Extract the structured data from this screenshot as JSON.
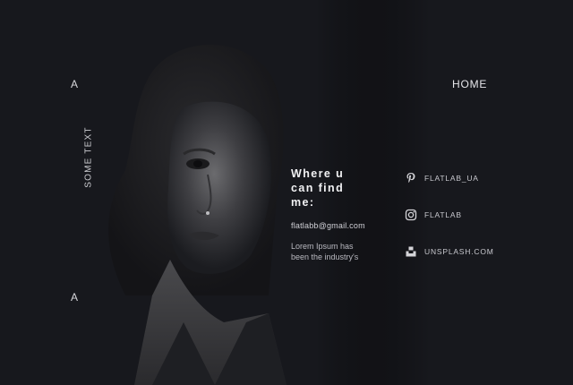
{
  "brand": {
    "logo_top": "A",
    "logo_bottom": "A",
    "vertical_text": "SOME TEXT"
  },
  "nav": {
    "home_label": "HOME"
  },
  "contact": {
    "heading_lines": [
      "Where u",
      "can find",
      "me:"
    ],
    "email": "flatlabb@gmail.com",
    "desc_lines": [
      "Lorem Ipsum has",
      "been the industry's"
    ]
  },
  "social": [
    {
      "icon": "pinterest-icon",
      "label": "FLATLAB_UA"
    },
    {
      "icon": "instagram-icon",
      "label": "FLATLAB"
    },
    {
      "icon": "unsplash-icon",
      "label": "UNSPLASH.COM"
    }
  ],
  "colors": {
    "background": "#17181d",
    "text": "#e8e8ea",
    "muted": "#b9b9c0"
  }
}
